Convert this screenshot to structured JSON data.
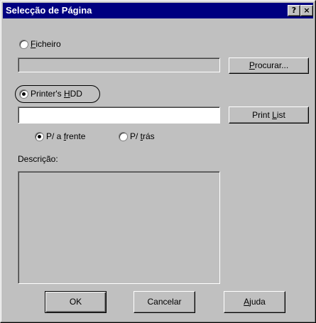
{
  "window": {
    "title": "Selecção de Página",
    "help_glyph": "?",
    "close_glyph": "×"
  },
  "source": {
    "file_option": {
      "pre": "",
      "key": "F",
      "post": "icheiro",
      "selected": false
    },
    "file_path_value": "",
    "browse": {
      "pre": "",
      "key": "P",
      "post": "rocurar..."
    },
    "hdd_option": {
      "pre": "Printer's ",
      "key": "H",
      "post": "DD",
      "selected": true
    },
    "hdd_value": "",
    "print_list": {
      "pre": "Print ",
      "key": "L",
      "post": "ist"
    }
  },
  "side": {
    "front": {
      "pre": "P/ a ",
      "key": "f",
      "post": "rente",
      "selected": true
    },
    "back": {
      "pre": "P/ ",
      "key": "t",
      "post": "rás",
      "selected": false
    }
  },
  "description": {
    "label": "Descrição:",
    "value": ""
  },
  "buttons": {
    "ok": "OK",
    "cancel": "Cancelar",
    "help": {
      "pre": "",
      "key": "A",
      "post": "juda"
    }
  }
}
